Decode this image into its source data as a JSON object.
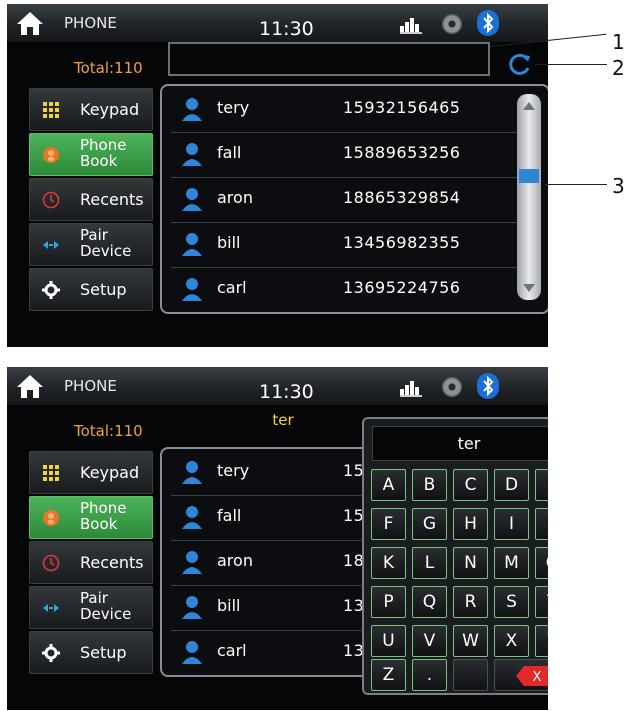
{
  "screen1": {
    "app_title": "PHONE",
    "time": "11:30",
    "total": "Total:110",
    "search_text": "",
    "sidebar": [
      {
        "label": "Keypad",
        "icon": "keypad-icon"
      },
      {
        "label": "Phone Book",
        "icon": "phonebook-icon"
      },
      {
        "label": "Recents",
        "icon": "clock-icon"
      },
      {
        "label": "Pair Device",
        "icon": "pair-icon"
      },
      {
        "label": "Setup",
        "icon": "gear-icon"
      }
    ],
    "contacts": [
      {
        "name": "tery",
        "number": "15932156465"
      },
      {
        "name": "fall",
        "number": "15889653256"
      },
      {
        "name": "aron",
        "number": "18865329854"
      },
      {
        "name": "bill",
        "number": "13456982355"
      },
      {
        "name": "carl",
        "number": "13695224756"
      }
    ]
  },
  "screen2": {
    "app_title": "PHONE",
    "time": "11:30",
    "total": "Total:110",
    "search_text": "ter",
    "keyboard_display": "ter",
    "sidebar": [
      {
        "label": "Keypad"
      },
      {
        "label": "Phone Book"
      },
      {
        "label": "Recents"
      },
      {
        "label": "Pair Device"
      },
      {
        "label": "Setup"
      }
    ],
    "contacts": [
      {
        "name": "tery",
        "number": "15"
      },
      {
        "name": "fall",
        "number": "15"
      },
      {
        "name": "aron",
        "number": "18"
      },
      {
        "name": "bill",
        "number": "13"
      },
      {
        "name": "carl",
        "number": "13"
      }
    ],
    "keys": [
      "A",
      "B",
      "C",
      "D",
      "E",
      "F",
      "G",
      "H",
      "I",
      "J",
      "K",
      "L",
      "N",
      "M",
      "O",
      "P",
      "Q",
      "R",
      "S",
      "T",
      "U",
      "V",
      "W",
      "X",
      "Y",
      "Z",
      "."
    ],
    "delete_label": "X"
  },
  "callouts": [
    "1",
    "2",
    "3"
  ],
  "colors": {
    "accent_green": "#4eb35a",
    "total_orange": "#f0a238",
    "search_yellow": "#f2d33a",
    "bluetooth_blue": "#1b6fd6"
  }
}
